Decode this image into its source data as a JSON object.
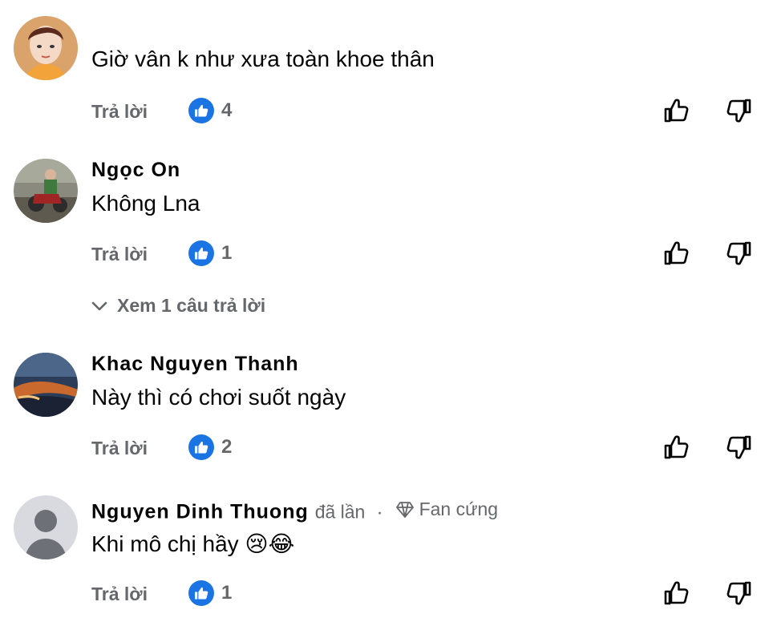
{
  "comments": [
    {
      "name": "",
      "text": "Giờ vân k như xưa toàn khoe thân",
      "reply_label": "Trả lời",
      "like_count": "4"
    },
    {
      "name": "Ngọc On",
      "text": "Không Lna",
      "reply_label": "Trả lời",
      "like_count": "1",
      "view_replies_label": "Xem 1 câu trả lời"
    },
    {
      "name": "Khac Nguyen Thanh",
      "text": "Này thì có chơi suốt ngày",
      "reply_label": "Trả lời",
      "like_count": "2"
    },
    {
      "name": "Nguyen Dinh Thuong",
      "name_suffix": "đã lần",
      "badge": "Fan cứng",
      "text": "Khi mô chị hầy 😢😂",
      "reply_label": "Trả lời",
      "like_count": "1"
    }
  ],
  "icons": {
    "like_reaction": "like-thumb-blue-icon",
    "thumb_up": "thumb-up-outline-icon",
    "thumb_down": "thumb-down-outline-icon",
    "chevron": "chevron-down-icon",
    "badge": "diamond-icon"
  },
  "colors": {
    "like_blue": "#1b74e4",
    "meta_gray": "#65676b",
    "text": "#050505"
  }
}
